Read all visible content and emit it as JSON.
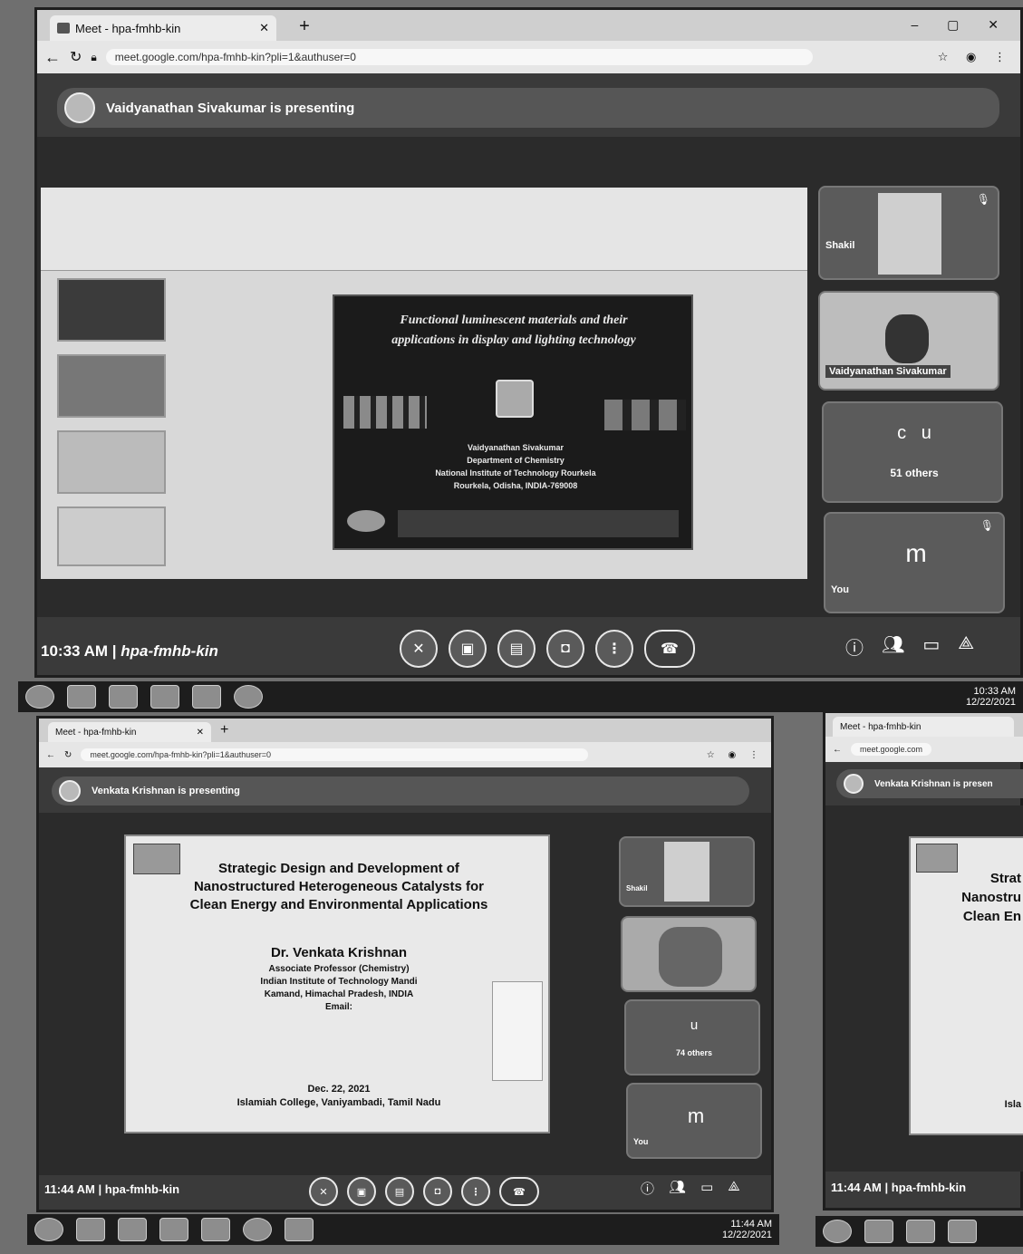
{
  "top": {
    "tab_title": "Meet - hpa-fmhb-kin",
    "url": "meet.google.com/hpa-fmhb-kin?pli=1&authuser=0",
    "presenter_banner": "Vaidyanathan Sivakumar is presenting",
    "slide": {
      "title_line1": "Functional luminescent materials and their",
      "title_line2": "applications in display and lighting technology",
      "author": "Vaidyanathan Sivakumar",
      "dept": "Department of Chemistry",
      "institute": "National Institute of Technology Rourkela",
      "address": "Rourkela, Odisha, INDIA-769008"
    },
    "tiles": {
      "participant1": "Shakil",
      "participant2": "Vaidyanathan Sivakumar",
      "others_initials": "c   u",
      "others_count": "51 others",
      "self_initial": "m",
      "self_label": "You"
    },
    "meeting_time": "10:33 AM",
    "meeting_code": "hpa-fmhb-kin",
    "clock_time": "10:33 AM",
    "clock_date": "12/22/2021"
  },
  "bottom_left": {
    "tab_title": "Meet - hpa-fmhb-kin",
    "url": "meet.google.com/hpa-fmhb-kin?pli=1&authuser=0",
    "presenter_banner": "Venkata Krishnan is presenting",
    "slide": {
      "title_line1": "Strategic Design and Development of",
      "title_line2": "Nanostructured Heterogeneous Catalysts for",
      "title_line3": "Clean Energy and Environmental Applications",
      "speaker": "Dr. Venkata Krishnan",
      "position": "Associate Professor (Chemistry)",
      "institute": "Indian Institute of Technology Mandi",
      "address": "Kamand, Himachal Pradesh, INDIA",
      "email_label": "Email:",
      "date": "Dec. 22, 2021",
      "venue": "Islamiah College, Vaniyambadi, Tamil Nadu"
    },
    "tiles": {
      "participant1": "Shakil",
      "others_initials": "u",
      "others_count": "74 others",
      "self_initial": "m",
      "self_label": "You"
    },
    "meeting_time": "11:44 AM",
    "meeting_code": "hpa-fmhb-kin",
    "clock_time": "11:44 AM",
    "clock_date": "12/22/2021"
  },
  "bottom_right": {
    "tab_title": "Meet - hpa-fmhb-kin",
    "url": "meet.google.com",
    "presenter_banner": "Venkata Krishnan is presen",
    "slide_fragments": [
      "Strat",
      "Nanostru",
      "Clean En",
      "Isla"
    ],
    "meeting_time": "11:44 AM",
    "meeting_code": "hpa-fmhb-kin"
  }
}
